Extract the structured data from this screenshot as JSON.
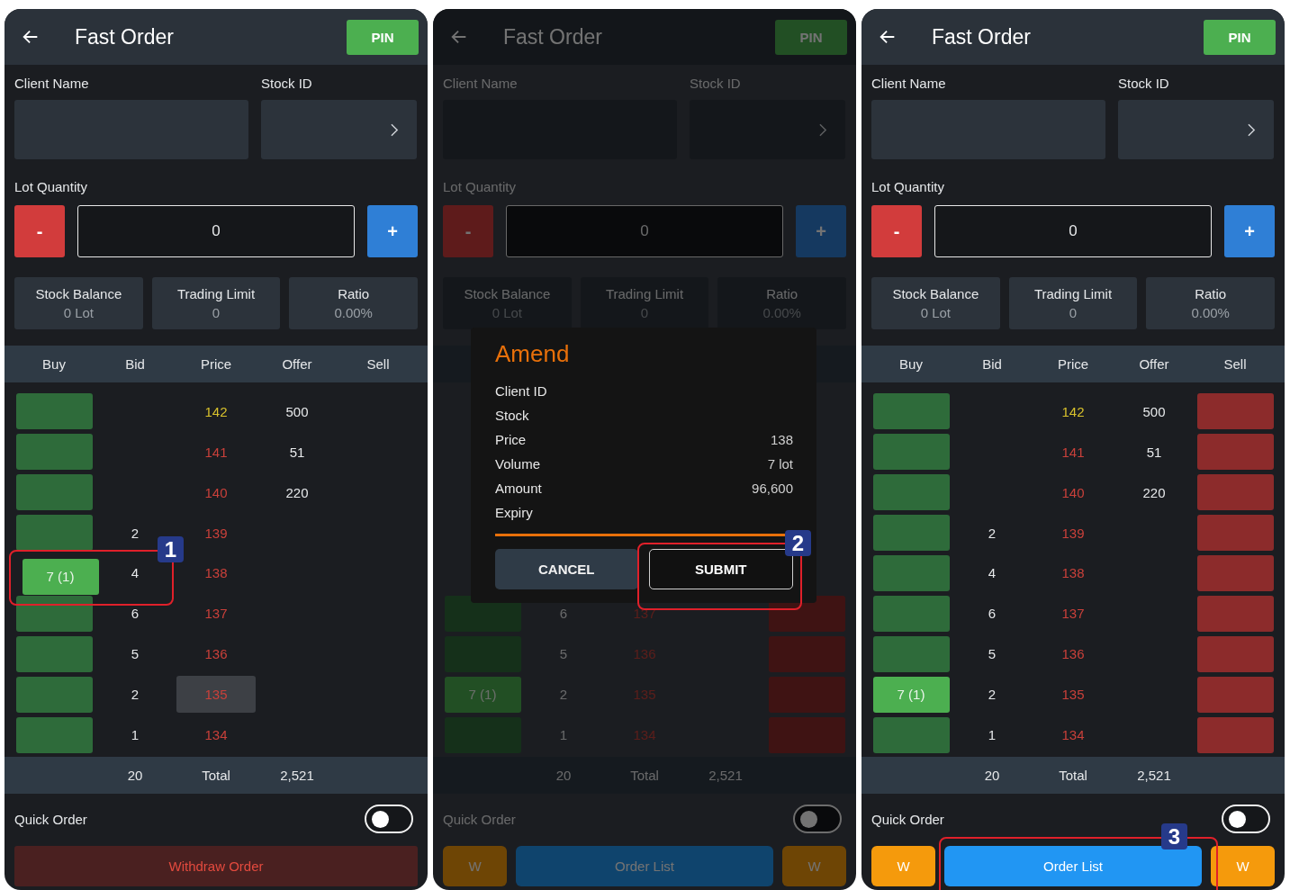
{
  "screens": [
    {
      "dimmed": false,
      "title": "Fast Order",
      "pin": "PIN",
      "client_label": "Client Name",
      "stock_label": "Stock ID",
      "lot_label": "Lot Quantity",
      "minus": "-",
      "quantity": "0",
      "plus": "+",
      "stats": [
        {
          "label": "Stock Balance",
          "value": "0 Lot"
        },
        {
          "label": "Trading Limit",
          "value": "0"
        },
        {
          "label": "Ratio",
          "value": "0.00%"
        }
      ],
      "columns": [
        "Buy",
        "Bid",
        "Price",
        "Offer",
        "Sell"
      ],
      "rows": [
        {
          "kind": "plain",
          "bid": "",
          "price": "142",
          "color": "#d8c12c",
          "price_selected": false,
          "offer": "500",
          "sell_bar": false
        },
        {
          "kind": "plain",
          "bid": "",
          "price": "141",
          "color": "#c9403a",
          "price_selected": false,
          "offer": "51",
          "sell_bar": false
        },
        {
          "kind": "plain",
          "bid": "",
          "price": "140",
          "color": "#c9403a",
          "price_selected": false,
          "offer": "220",
          "sell_bar": false
        },
        {
          "kind": "plain",
          "bid": "2",
          "price": "139",
          "color": "#c9403a",
          "price_selected": false,
          "offer": "",
          "sell_bar": false
        },
        {
          "kind": "dragging",
          "buy": "7 (1)",
          "bid": "4",
          "price": "138",
          "color": "#c9403a",
          "price_selected": false,
          "offer": "",
          "sell_bar": false
        },
        {
          "kind": "plain",
          "bid": "6",
          "price": "137",
          "color": "#c9403a",
          "price_selected": false,
          "offer": "",
          "sell_bar": false
        },
        {
          "kind": "plain",
          "bid": "5",
          "price": "136",
          "color": "#c9403a",
          "price_selected": false,
          "offer": "",
          "sell_bar": false
        },
        {
          "kind": "plain",
          "bid": "2",
          "price": "135",
          "color": "#c9403a",
          "price_selected": true,
          "offer": "",
          "sell_bar": false
        },
        {
          "kind": "plain",
          "bid": "1",
          "price": "134",
          "color": "#c9403a",
          "price_selected": false,
          "offer": "",
          "sell_bar": false
        }
      ],
      "total": {
        "bid": "20",
        "label": "Total",
        "offer": "2,521"
      },
      "quick_order": {
        "label": "Quick Order",
        "on": false
      },
      "footer": [
        {
          "kind": "withdraw",
          "label": "Withdraw Order"
        }
      ],
      "annotation": "1"
    },
    {
      "dimmed": true,
      "title": "Fast Order",
      "pin": "PIN",
      "client_label": "Client Name",
      "stock_label": "Stock ID",
      "lot_label": "Lot Quantity",
      "minus": "-",
      "quantity": "0",
      "plus": "+",
      "stats": [
        {
          "label": "Stock Balance",
          "value": "0 Lot"
        },
        {
          "label": "Trading Limit",
          "value": "0"
        },
        {
          "label": "Ratio",
          "value": "0.00%"
        }
      ],
      "rows": [
        {
          "kind": "plain",
          "bid": "6",
          "price": "137",
          "price_selected": false,
          "offer": "",
          "sell_bar": true
        },
        {
          "kind": "plain",
          "bid": "5",
          "price": "136",
          "price_selected": false,
          "offer": "",
          "sell_bar": true
        },
        {
          "kind": "order",
          "buy": "7 (1)",
          "bid": "2",
          "price": "135",
          "price_selected": false,
          "offer": "",
          "sell_bar": true
        },
        {
          "kind": "plain",
          "bid": "1",
          "price": "134",
          "price_selected": false,
          "offer": "",
          "sell_bar": true
        }
      ],
      "total": {
        "bid": "20",
        "label": "Total",
        "offer": "2,521"
      },
      "quick_order": {
        "label": "Quick Order",
        "on": false
      },
      "footer": [
        {
          "kind": "w",
          "label": "W"
        },
        {
          "kind": "list",
          "label": "Order List"
        },
        {
          "kind": "w",
          "label": "W"
        }
      ],
      "dialog": {
        "title": "Amend",
        "rows": [
          {
            "label": "Client ID",
            "value": ""
          },
          {
            "label": "Stock",
            "value": ""
          },
          {
            "label": "Price",
            "value": "138"
          },
          {
            "label": "Volume",
            "value": "7 lot"
          },
          {
            "label": "Amount",
            "value": "96,600"
          },
          {
            "label": "Expiry",
            "value": ""
          }
        ],
        "cancel": "CANCEL",
        "submit": "SUBMIT"
      },
      "annotation": "2"
    },
    {
      "dimmed": false,
      "title": "Fast Order",
      "pin": "PIN",
      "client_label": "Client Name",
      "stock_label": "Stock ID",
      "lot_label": "Lot Quantity",
      "minus": "-",
      "quantity": "0",
      "plus": "+",
      "stats": [
        {
          "label": "Stock Balance",
          "value": "0 Lot"
        },
        {
          "label": "Trading Limit",
          "value": "0"
        },
        {
          "label": "Ratio",
          "value": "0.00%"
        }
      ],
      "columns": [
        "Buy",
        "Bid",
        "Price",
        "Offer",
        "Sell"
      ],
      "rows": [
        {
          "kind": "plain",
          "bid": "",
          "price": "142",
          "color": "#d8c12c",
          "price_selected": false,
          "offer": "500",
          "sell_bar": true
        },
        {
          "kind": "plain",
          "bid": "",
          "price": "141",
          "color": "#c9403a",
          "price_selected": false,
          "offer": "51",
          "sell_bar": true
        },
        {
          "kind": "plain",
          "bid": "",
          "price": "140",
          "color": "#c9403a",
          "price_selected": false,
          "offer": "220",
          "sell_bar": true
        },
        {
          "kind": "plain",
          "bid": "2",
          "price": "139",
          "color": "#c9403a",
          "price_selected": false,
          "offer": "",
          "sell_bar": true
        },
        {
          "kind": "plain",
          "bid": "4",
          "price": "138",
          "color": "#c9403a",
          "price_selected": false,
          "offer": "",
          "sell_bar": true
        },
        {
          "kind": "plain",
          "bid": "6",
          "price": "137",
          "color": "#c9403a",
          "price_selected": false,
          "offer": "",
          "sell_bar": true
        },
        {
          "kind": "plain",
          "bid": "5",
          "price": "136",
          "color": "#c9403a",
          "price_selected": false,
          "offer": "",
          "sell_bar": true
        },
        {
          "kind": "order",
          "buy": "7 (1)",
          "bid": "2",
          "price": "135",
          "color": "#c9403a",
          "price_selected": false,
          "offer": "",
          "sell_bar": true
        },
        {
          "kind": "plain",
          "bid": "1",
          "price": "134",
          "color": "#c9403a",
          "price_selected": false,
          "offer": "",
          "sell_bar": true
        }
      ],
      "total": {
        "bid": "20",
        "label": "Total",
        "offer": "2,521"
      },
      "quick_order": {
        "label": "Quick Order",
        "on": false
      },
      "footer": [
        {
          "kind": "w",
          "label": "W"
        },
        {
          "kind": "list",
          "label": "Order List"
        },
        {
          "kind": "w",
          "label": "W"
        }
      ],
      "annotation": "3"
    }
  ]
}
